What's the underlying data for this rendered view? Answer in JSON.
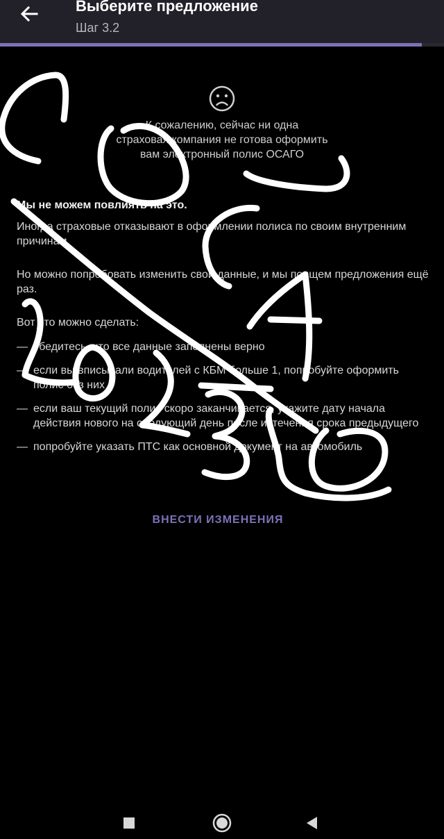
{
  "appbar": {
    "title": "Выберите предложение",
    "subtitle": "Шаг 3.2",
    "background": "#222028"
  },
  "progress": {
    "value": 0.95,
    "color": "#7d72b8"
  },
  "empty_state": {
    "icon": "sad-face-icon",
    "message": "К сожалению, сейчас ни одна\nстраховая компания не готова оформить\nвам электронный полис ОСАГО"
  },
  "content": {
    "heading": "Мы не можем повлиять на это.",
    "paragraph1": "Иногда страховые отказывают в оформлении полиса по своим внутренним причинам.",
    "paragraph2": "Но можно попробовать изменить свои данные, и мы поищем предложения ещё раз.",
    "paragraph3": "Вот что можно сделать:",
    "bullet_marker": "—",
    "tips": [
      "убедитесь, что все данные заполнены верно",
      "если вы вписывали водителей с КБМ больше 1, попробуйте оформить полис без них",
      "если ваш текущий полис скоро заканчивается, укажите дату начала действия нового на следующий день после истечения срока предыдущего",
      "попробуйте указать ПТС как основной документ на автомобиль"
    ]
  },
  "action": {
    "label": "ВНЕСТИ ИЗМЕНЕНИЯ",
    "color": "#7d72b8"
  },
  "navbar": {
    "icons": [
      "recents-square-icon",
      "home-circle-icon",
      "back-triangle-icon"
    ]
  }
}
